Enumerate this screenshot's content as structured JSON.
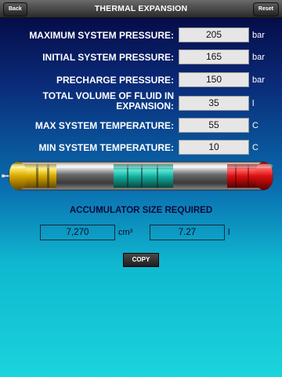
{
  "header": {
    "title": "THERMAL EXPANSION",
    "back_label": "Back",
    "reset_label": "Reset"
  },
  "inputs": [
    {
      "label": "MAXIMUM SYSTEM PRESSURE:",
      "value": "205",
      "unit": "bar"
    },
    {
      "label": "INITIAL SYSTEM PRESSURE:",
      "value": "165",
      "unit": "bar"
    },
    {
      "label": "PRECHARGE PRESSURE:",
      "value": "150",
      "unit": "bar"
    },
    {
      "label_line1": "TOTAL VOLUME OF FLUID IN",
      "label_line2": "EXPANSION:",
      "value": "35",
      "unit": "l"
    },
    {
      "label": "MAX SYSTEM TEMPERATURE:",
      "value": "55",
      "unit": "C"
    },
    {
      "label": "MIN SYSTEM TEMPERATURE:",
      "value": "10",
      "unit": "C"
    }
  ],
  "result": {
    "title": "ACCUMULATOR SIZE REQUIRED",
    "cm3_value": "7,270",
    "cm3_unit": "cm³",
    "l_value": "7.27",
    "l_unit": "l"
  },
  "copy_label": "COPY",
  "colors": {
    "gas_end": "#e8c020",
    "piston": "#1ab0a8",
    "fluid_end": "#e01818"
  }
}
